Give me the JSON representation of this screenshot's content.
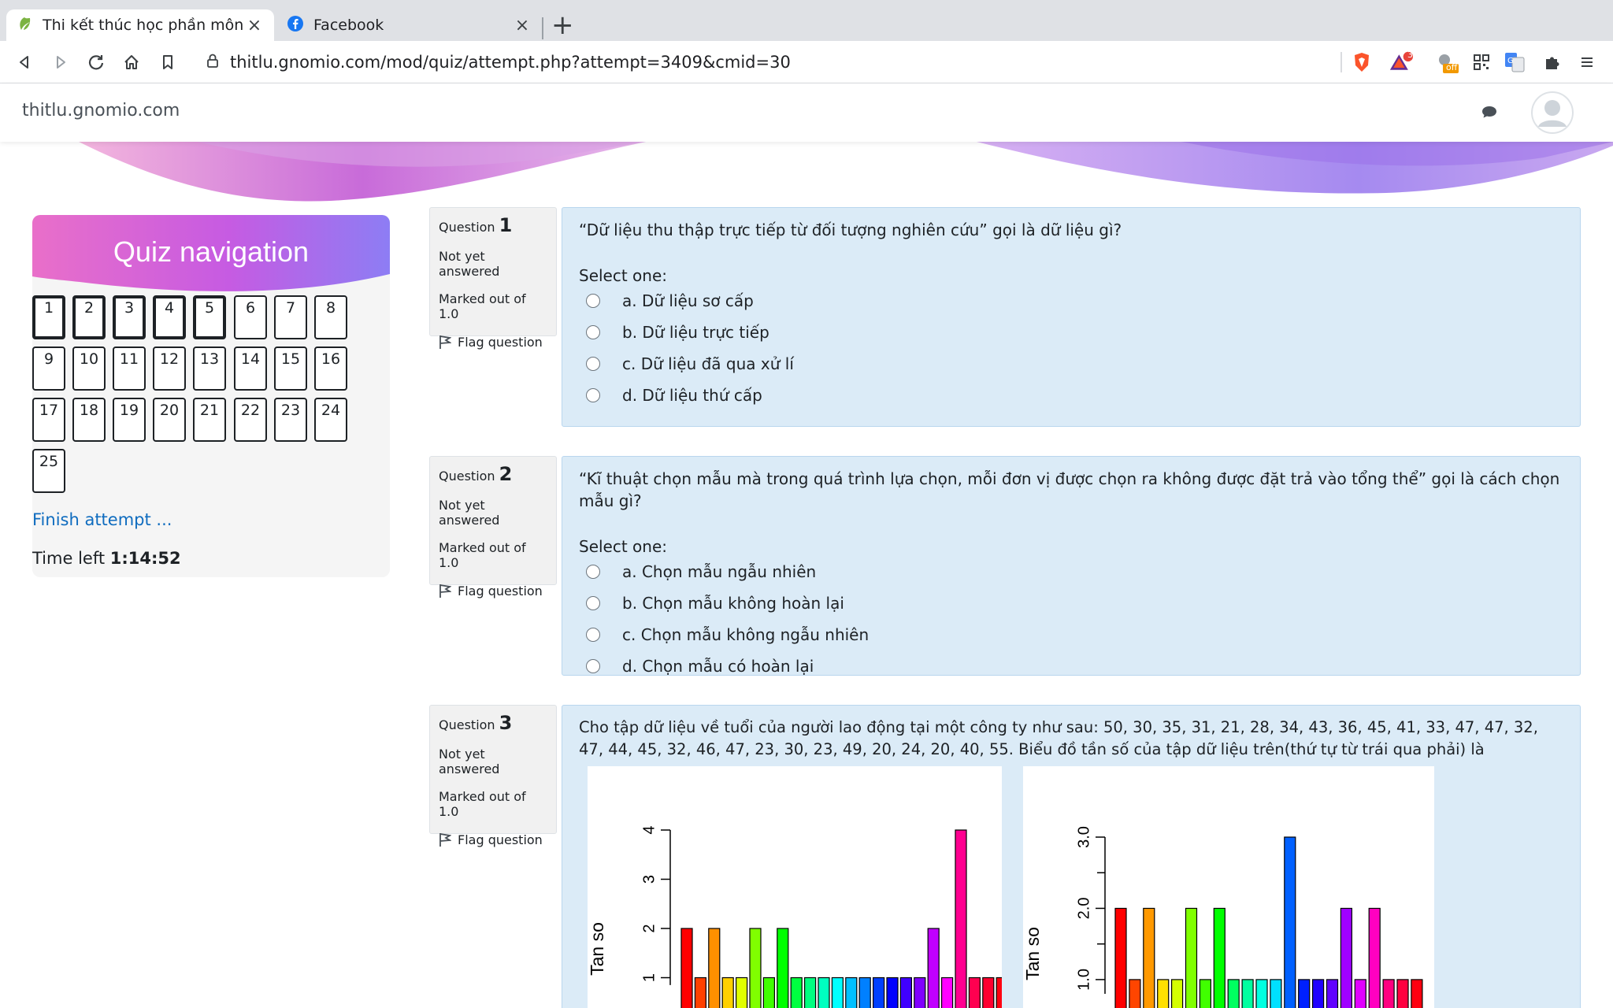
{
  "browser": {
    "tabs": [
      {
        "title": "Thi kết thúc học phần môn Thống kê",
        "active": true
      },
      {
        "title": "Facebook",
        "active": false
      }
    ],
    "url": "thitlu.gnomio.com/mod/quiz/attempt.php?attempt=3409&cmid=30",
    "extension_badge": "3",
    "extension_off_label": "off"
  },
  "site": {
    "brand": "thitlu.gnomio.com"
  },
  "nav": {
    "title": "Quiz navigation",
    "questions": [
      "1",
      "2",
      "3",
      "4",
      "5",
      "6",
      "7",
      "8",
      "9",
      "10",
      "11",
      "12",
      "13",
      "14",
      "15",
      "16",
      "17",
      "18",
      "19",
      "20",
      "21",
      "22",
      "23",
      "24",
      "25"
    ],
    "finish_label": "Finish attempt ...",
    "time_label": "Time left",
    "time_value": "1:14:52"
  },
  "questions": [
    {
      "label": "Question",
      "number": "1",
      "status": "Not yet answered",
      "marks": "Marked out of 1.0",
      "flag": "Flag question",
      "text": "“Dữ liệu thu thập trực tiếp từ đối tượng nghiên cứu” gọi là dữ liệu gì?",
      "select": "Select one:",
      "options": [
        "a. Dữ liệu sơ cấp",
        "b. Dữ liệu trực tiếp",
        "c. Dữ liệu đã qua xử lí",
        "d. Dữ liệu thứ cấp"
      ]
    },
    {
      "label": "Question",
      "number": "2",
      "status": "Not yet answered",
      "marks": "Marked out of 1.0",
      "flag": "Flag question",
      "text": "“Kĩ thuật chọn mẫu mà trong quá trình lựa chọn, mỗi đơn vị được chọn ra không được đặt trả vào tổng thể” gọi là cách chọn mẫu gì?",
      "select": "Select one:",
      "options": [
        "a. Chọn mẫu ngẫu nhiên",
        "b. Chọn mẫu không hoàn lại",
        "c. Chọn mẫu không ngẫu nhiên",
        "d. Chọn mẫu có hoàn lại"
      ]
    },
    {
      "label": "Question",
      "number": "3",
      "status": "Not yet answered",
      "marks": "Marked out of 1.0",
      "flag": "Flag question",
      "text": "Cho tập dữ liệu về tuổi của người lao động tại một công ty như sau: 50, 30, 35, 31, 21, 28, 34, 43, 36, 45, 41, 33, 47, 47, 32, 47, 44, 45, 32, 46, 47, 23, 30, 23, 49, 20, 24, 20, 40, 55. Biểu đồ tần số của tập dữ liệu trên(thứ tự từ trái qua phải) là"
    }
  ],
  "chart_data": [
    {
      "type": "bar",
      "ylabel": "Tan so",
      "ytick_labels": [
        "1",
        "2",
        "3",
        "4"
      ],
      "ylim": [
        0,
        4
      ],
      "values": [
        2,
        1,
        2,
        1,
        1,
        2,
        1,
        2,
        1,
        1,
        1,
        1,
        1,
        1,
        1,
        1,
        1,
        1,
        2,
        1,
        4,
        1,
        1,
        1
      ],
      "colors": [
        "#ff0000",
        "#ff4000",
        "#ff9000",
        "#ffd000",
        "#e0ff00",
        "#80ff00",
        "#40ff00",
        "#00ff00",
        "#00ff40",
        "#00ff80",
        "#00ffc0",
        "#00ffff",
        "#00c0ff",
        "#0080ff",
        "#0040ff",
        "#0000ff",
        "#4000ff",
        "#8000ff",
        "#c000ff",
        "#ff00ff",
        "#ff0090",
        "#ff0050",
        "#ff0030",
        "#ff0010"
      ]
    },
    {
      "type": "bar",
      "ylabel": "Tan so",
      "ytick_labels": [
        "1.0",
        "2.0",
        "3.0"
      ],
      "ylim": [
        0.8,
        3.0
      ],
      "values": [
        2,
        1,
        2,
        1,
        1,
        2,
        1,
        2,
        1,
        1,
        1,
        1,
        3,
        1,
        1,
        1,
        2,
        1,
        2,
        1,
        1,
        1
      ],
      "colors": [
        "#ff0000",
        "#ff4500",
        "#ff9900",
        "#ffe000",
        "#d4ff00",
        "#80ff00",
        "#40ff00",
        "#00ff00",
        "#00ff60",
        "#00ffa0",
        "#00ffe0",
        "#00e0ff",
        "#0060ff",
        "#0020ff",
        "#2000ff",
        "#6000ff",
        "#a000ff",
        "#e000ff",
        "#ff00c0",
        "#ff0080",
        "#ff0040",
        "#ff0010"
      ]
    }
  ]
}
